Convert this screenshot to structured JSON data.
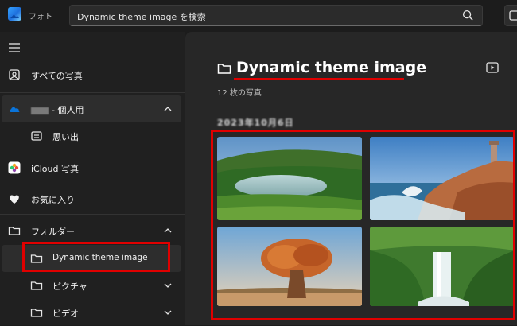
{
  "app": {
    "title": "フォト"
  },
  "search": {
    "value": "Dynamic theme image を検索"
  },
  "sidebar": {
    "all_photos": "すべての写真",
    "onedrive_label": "- 個人用",
    "memories": "思い出",
    "icloud": "iCloud 写真",
    "favorites": "お気に入り",
    "folders": "フォルダー",
    "folder_items": [
      {
        "label": "Dynamic theme image"
      },
      {
        "label": "ピクチャ"
      },
      {
        "label": "ビデオ"
      }
    ]
  },
  "main": {
    "title": "Dynamic theme image",
    "count": "12 枚の写真",
    "date_header": "2023年10月6日"
  },
  "photos": [
    {
      "name": "crater-lake"
    },
    {
      "name": "coastal-rocks-lighthouse"
    },
    {
      "name": "baobab-tree"
    },
    {
      "name": "waterfall"
    }
  ],
  "colors": {
    "highlight": "#e00000",
    "accent": "#0a74da",
    "background": "#1c1c1c"
  }
}
